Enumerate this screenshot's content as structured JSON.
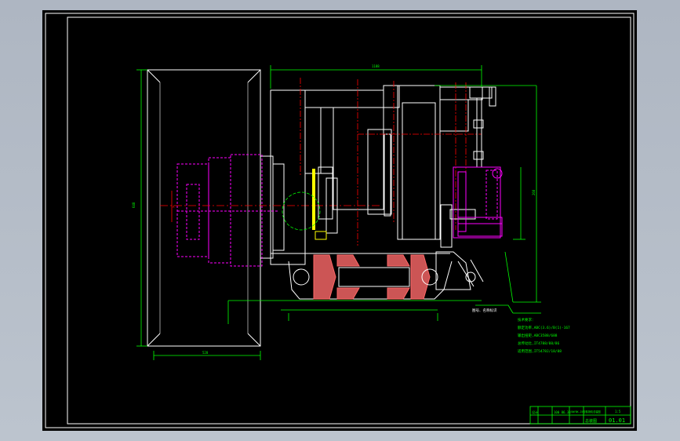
{
  "colors": {
    "background": "#b4bcc7",
    "sheet": "#000000",
    "frame": "#ffffff",
    "outline": "#ffffff",
    "dimension": "#00ff00",
    "centerline": "#ff0000",
    "hidden": "#ff00ff",
    "section": "#ff6666",
    "highlight": "#ffff00"
  },
  "notes": {
    "lines": [
      "技术要求：",
      "额定功率,ABC(3.6)/B(1)-167",
      "输出扭矩,ABC3588/688",
      "总传动比,IT4788/88/86",
      "适用范围,IT5478J/18/88"
    ],
    "callout": "图号、名称标识",
    "note_marker": "A"
  },
  "dimensions": {
    "overall_width": "1188",
    "left_height": "648",
    "right_height": "268",
    "base_width": "528"
  },
  "title_block": {
    "unit_label": "设计",
    "spec": "100 86.38",
    "name": "SWY8K-25型卷扬机总装图",
    "scale": "1:5",
    "sheet_no": "01.01",
    "material": "总装图"
  }
}
